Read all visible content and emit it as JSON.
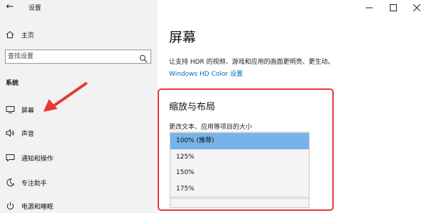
{
  "window": {
    "title": "设置"
  },
  "sidebar": {
    "home_label": "主页",
    "search": {
      "placeholder": "查找设置"
    },
    "section_label": "系统",
    "items": [
      {
        "label": "屏幕"
      },
      {
        "label": "声音"
      },
      {
        "label": "通知和操作"
      },
      {
        "label": "专注助手"
      },
      {
        "label": "电源和睡眠"
      }
    ]
  },
  "main": {
    "title": "屏幕",
    "hdr_text": "让支持 HDR 的视频、游戏和应用的画面更明亮、更生动。",
    "hdr_link": "Windows HD Color 设置",
    "scale_section": {
      "heading": "缩放与布局",
      "field_label": "更改文本、应用等项目的大小",
      "options": [
        "100% (推荐)",
        "125%",
        "150%",
        "175%"
      ],
      "selected": "100% (推荐)"
    }
  },
  "colors": {
    "accent": "#0067b8",
    "highlight": "#e53935",
    "selected": "#77b3e8"
  }
}
